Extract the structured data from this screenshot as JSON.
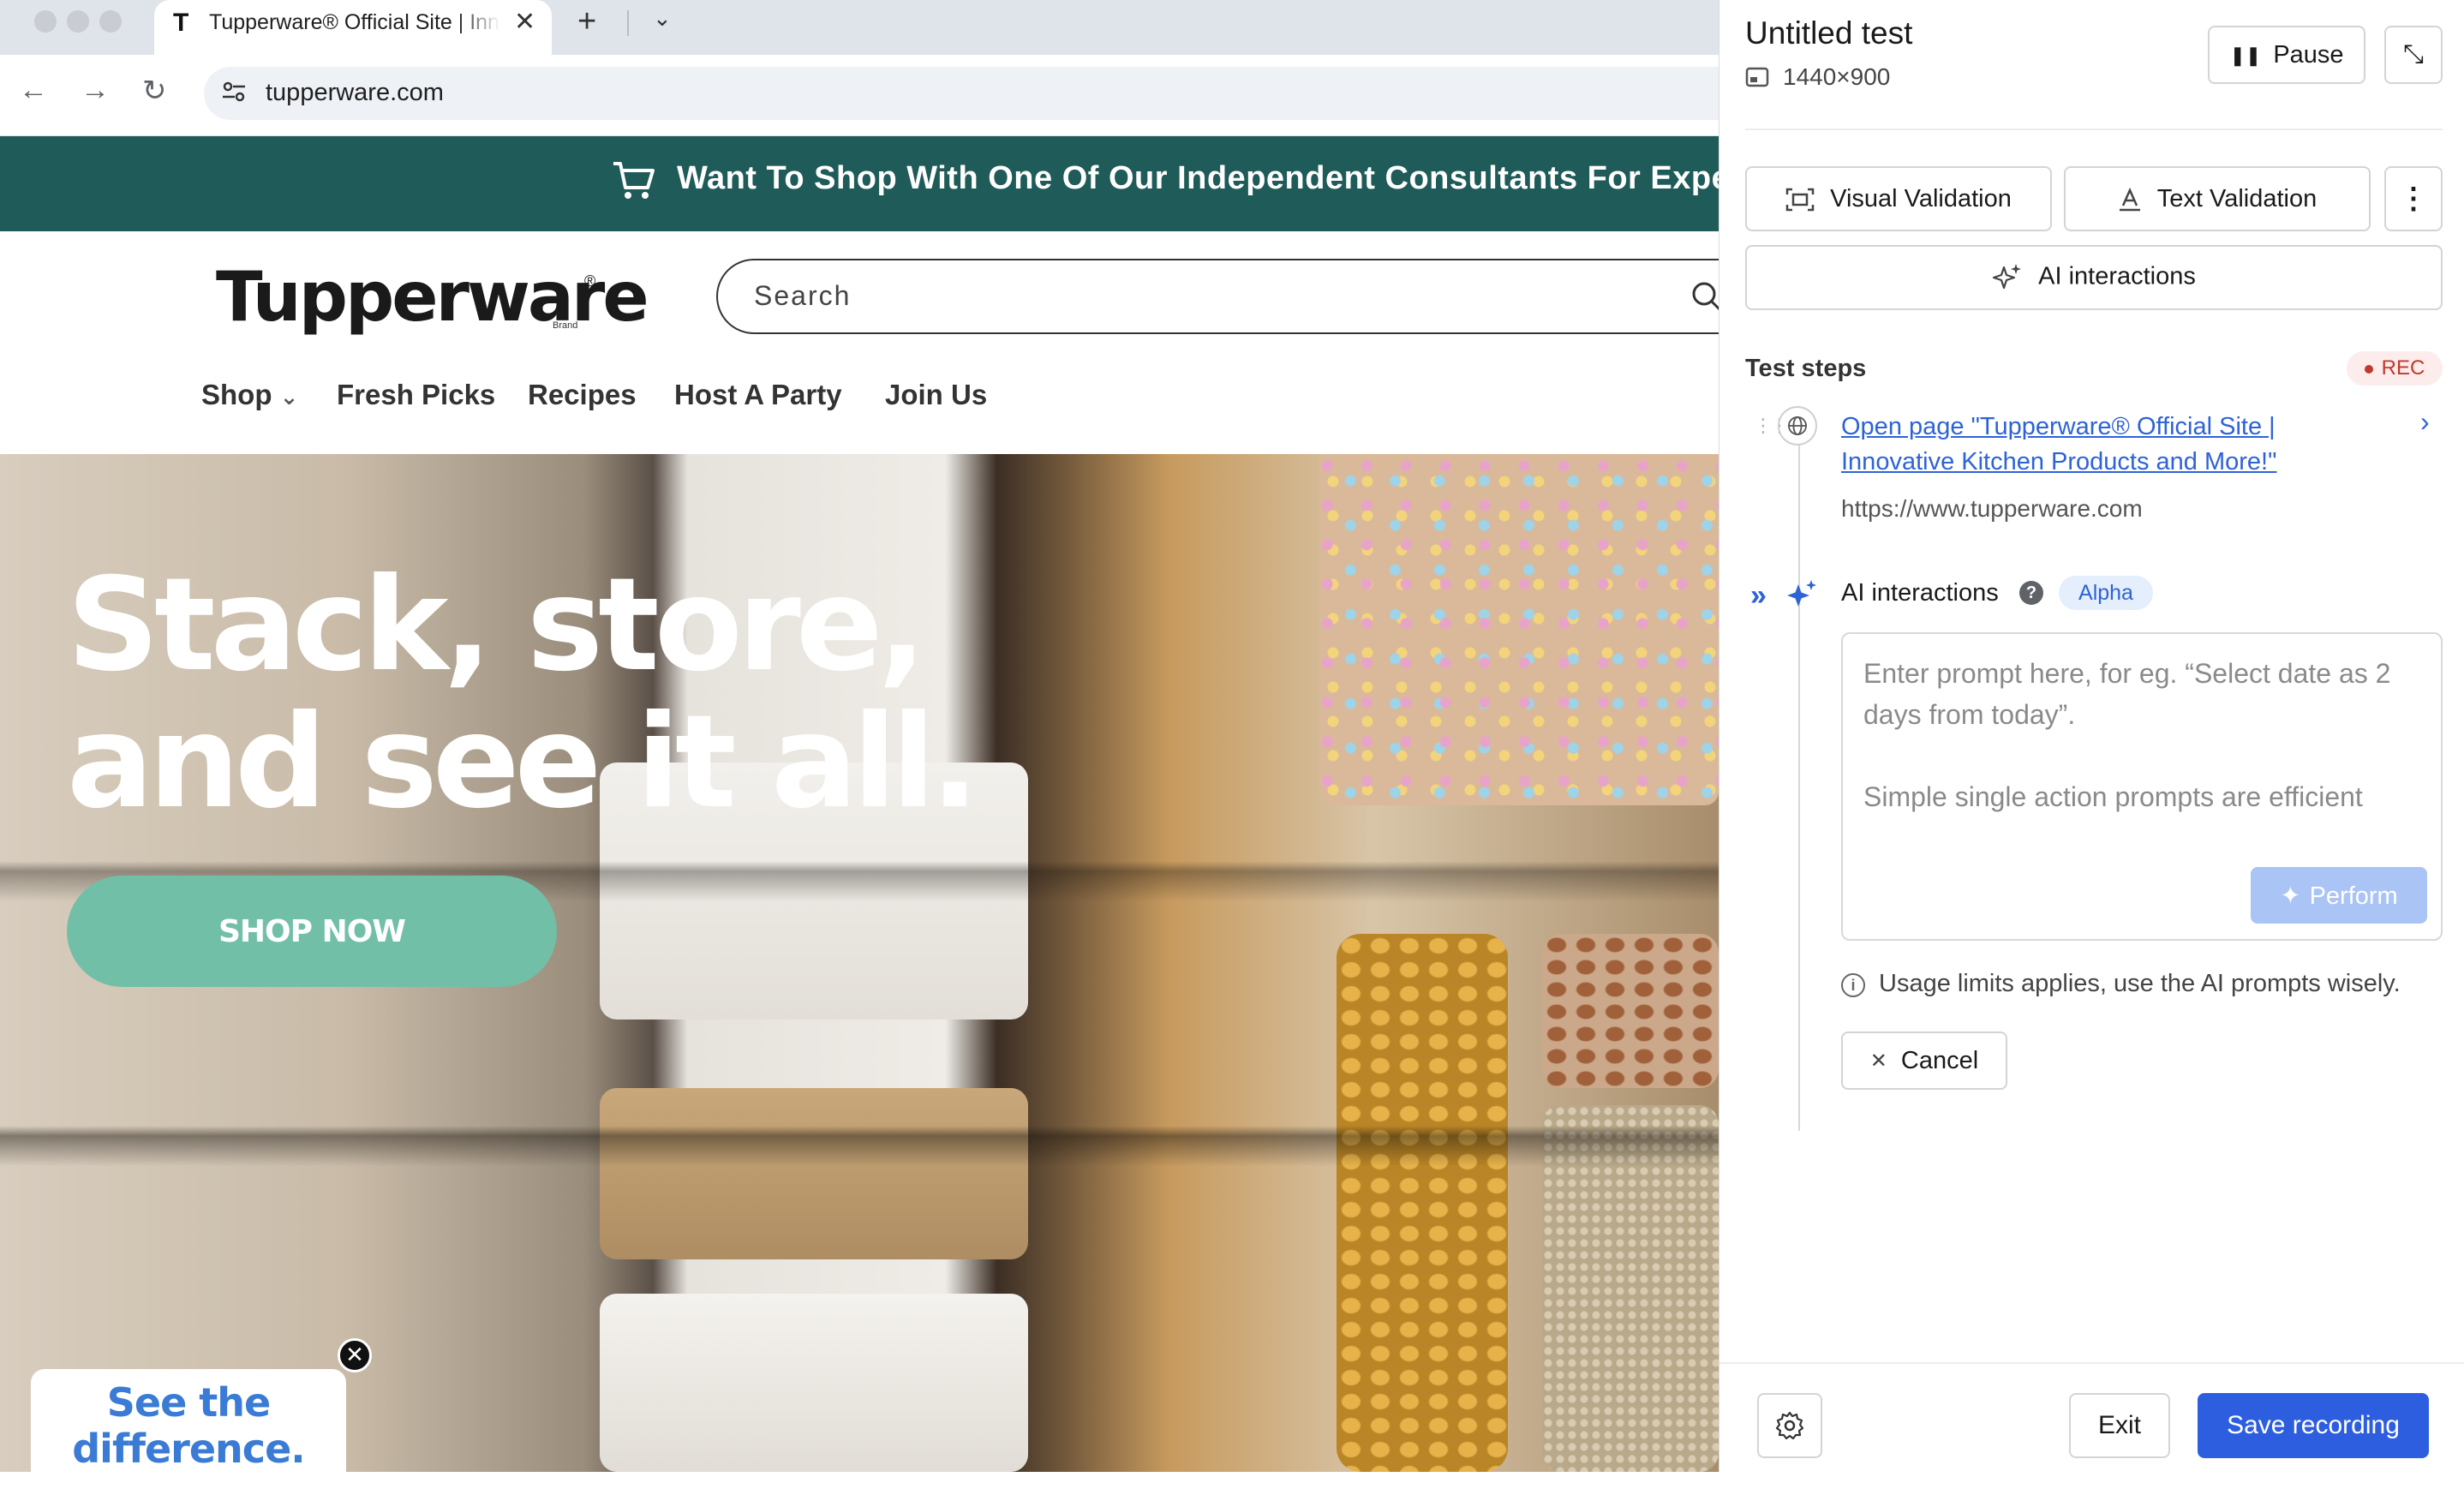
{
  "browser": {
    "tab_title": "Tupperware® Official Site | Innovative Kitchen Products and More!",
    "tab_favicon": "T",
    "tab_close": "✕",
    "new_tab": "+",
    "tab_menu": "⌄",
    "url": "tupperware.com",
    "nav": {
      "back": "←",
      "forward": "→",
      "reload": "↻"
    }
  },
  "site": {
    "promo_text": "Want To Shop With One Of Our Independent Consultants For Expert Advice?",
    "logo": "Tupperware",
    "logo_reg": "®",
    "logo_brand": "Brand",
    "search_placeholder": "Search",
    "menu": [
      "Shop",
      "Fresh Picks",
      "Recipes",
      "Host A Party",
      "Join Us"
    ],
    "shop_chevron": "⌄",
    "hero_title": "Stack, store,\nand see it all.",
    "hero_cta": "SHOP NOW",
    "popup_text": "See the difference.",
    "popup_close": "✕"
  },
  "panel": {
    "title": "Untitled test",
    "resolution": "1440×900",
    "pause_label": "Pause",
    "pause_icon": "❚❚",
    "collapse_icon": "⤡",
    "visual_validation": "Visual Validation",
    "text_validation": "Text Validation",
    "more_icon": "⋮",
    "ai_interactions_button": "AI interactions",
    "steps_title": "Test steps",
    "rec_label": "REC",
    "step1": {
      "link": "Open page \"Tupperware® Official Site | Innovative Kitchen Products and More!\"",
      "url": "https://www.tupperware.com",
      "chevron": "›"
    },
    "ai_step": {
      "expand_icon": "»",
      "label": "AI interactions",
      "help": "?",
      "badge": "Alpha",
      "prompt_placeholder": "Enter prompt here, for eg. “Select date as 2 days from today”.\n\nSimple single action prompts are efficient",
      "perform_label": "Perform"
    },
    "usage_note": "Usage limits applies, use the AI prompts wisely.",
    "info_icon": "i",
    "cancel_label": "Cancel",
    "cancel_icon": "✕",
    "exit_label": "Exit",
    "save_label": "Save recording"
  },
  "colors": {
    "promo_bg": "#1f5b58",
    "cta_bg": "#72bfa8",
    "accent_blue": "#2d5ee0",
    "link_blue": "#2e63d6",
    "rec_red": "#c0392b"
  }
}
